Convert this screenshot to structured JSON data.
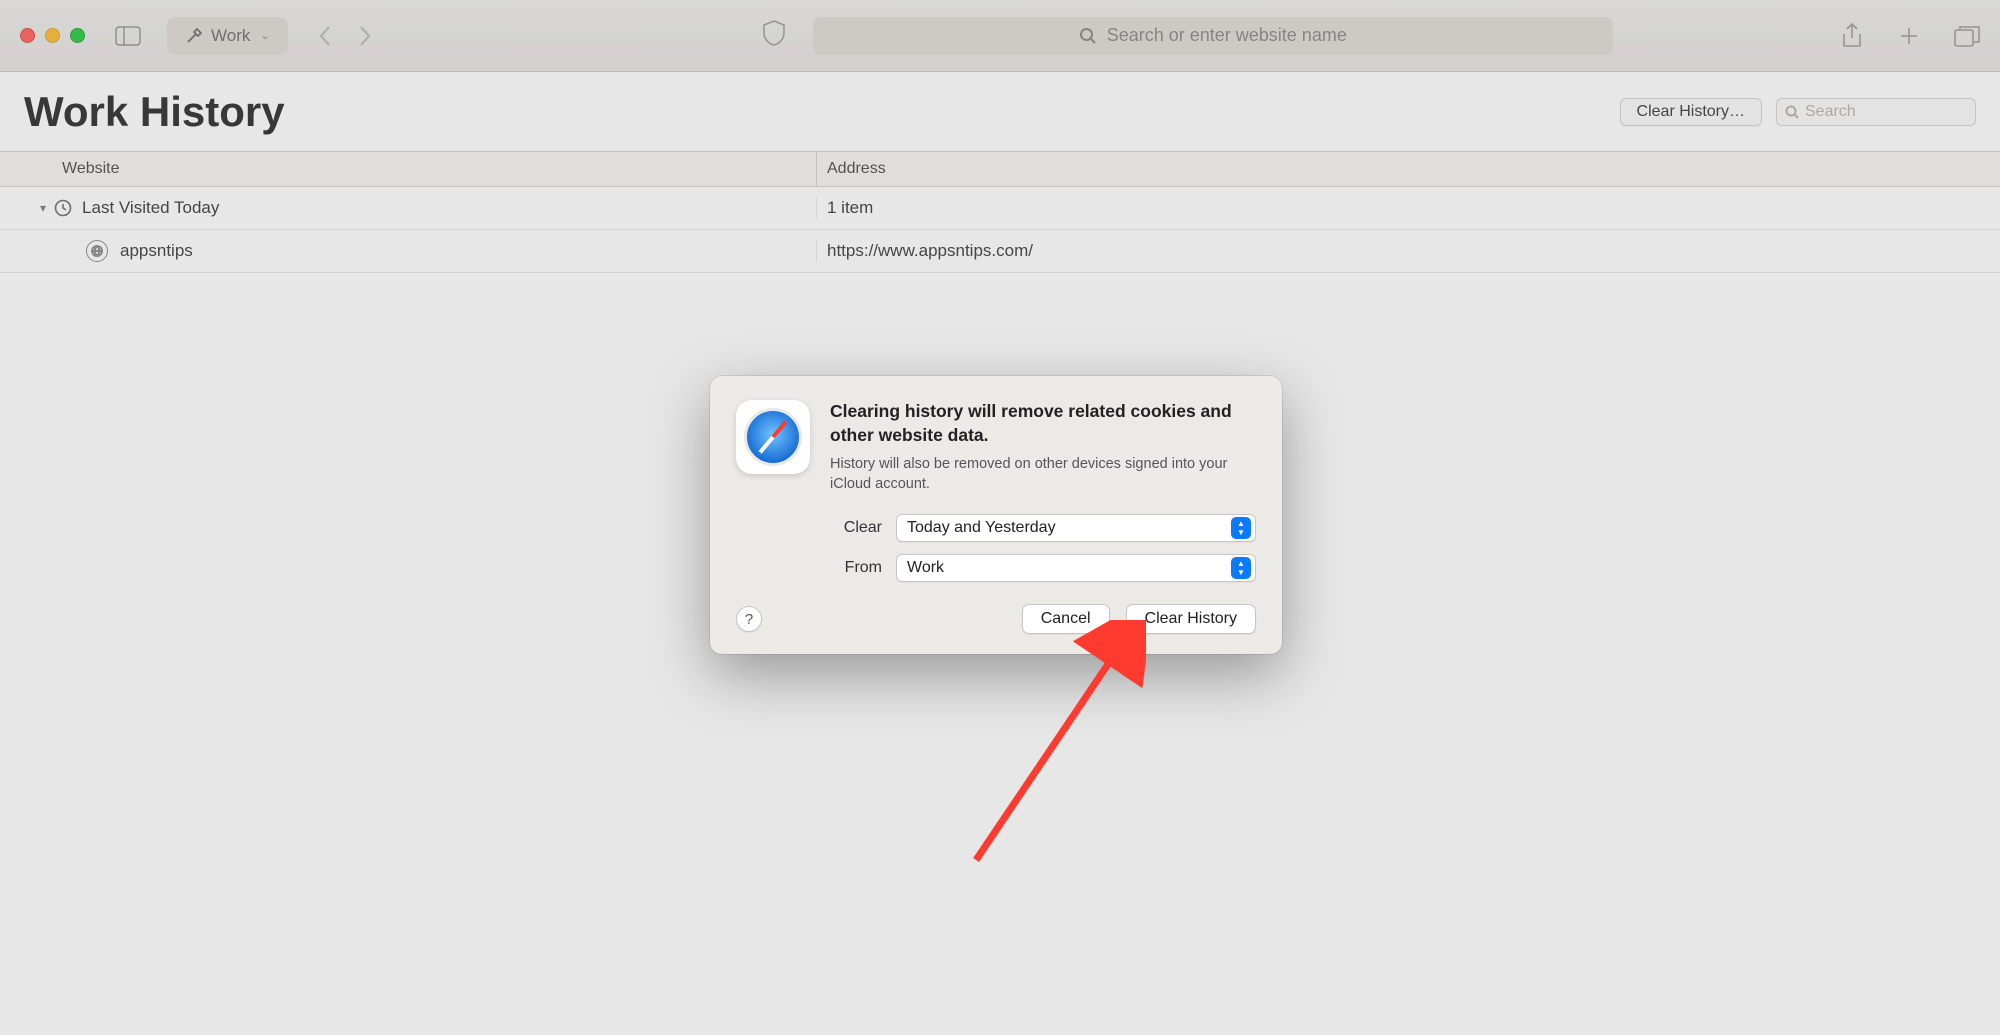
{
  "toolbar": {
    "profile_label": "Work",
    "url_placeholder": "Search or enter website name"
  },
  "header": {
    "title": "Work History",
    "clear_history_button": "Clear History…",
    "search_placeholder": "Search"
  },
  "columns": {
    "website": "Website",
    "address": "Address"
  },
  "history": {
    "group_label": "Last Visited Today",
    "group_count": "1 item",
    "entries": [
      {
        "site": "appsntips",
        "url": "https://www.appsntips.com/"
      }
    ]
  },
  "dialog": {
    "heading": "Clearing history will remove related cookies and other website data.",
    "subtext": "History will also be removed on other devices signed into your iCloud account.",
    "clear_label": "Clear",
    "clear_value": "Today and Yesterday",
    "from_label": "From",
    "from_value": "Work",
    "help_label": "?",
    "cancel_label": "Cancel",
    "confirm_label": "Clear History"
  },
  "colors": {
    "accent": "#0a7bff",
    "arrow": "#ff3b30"
  }
}
